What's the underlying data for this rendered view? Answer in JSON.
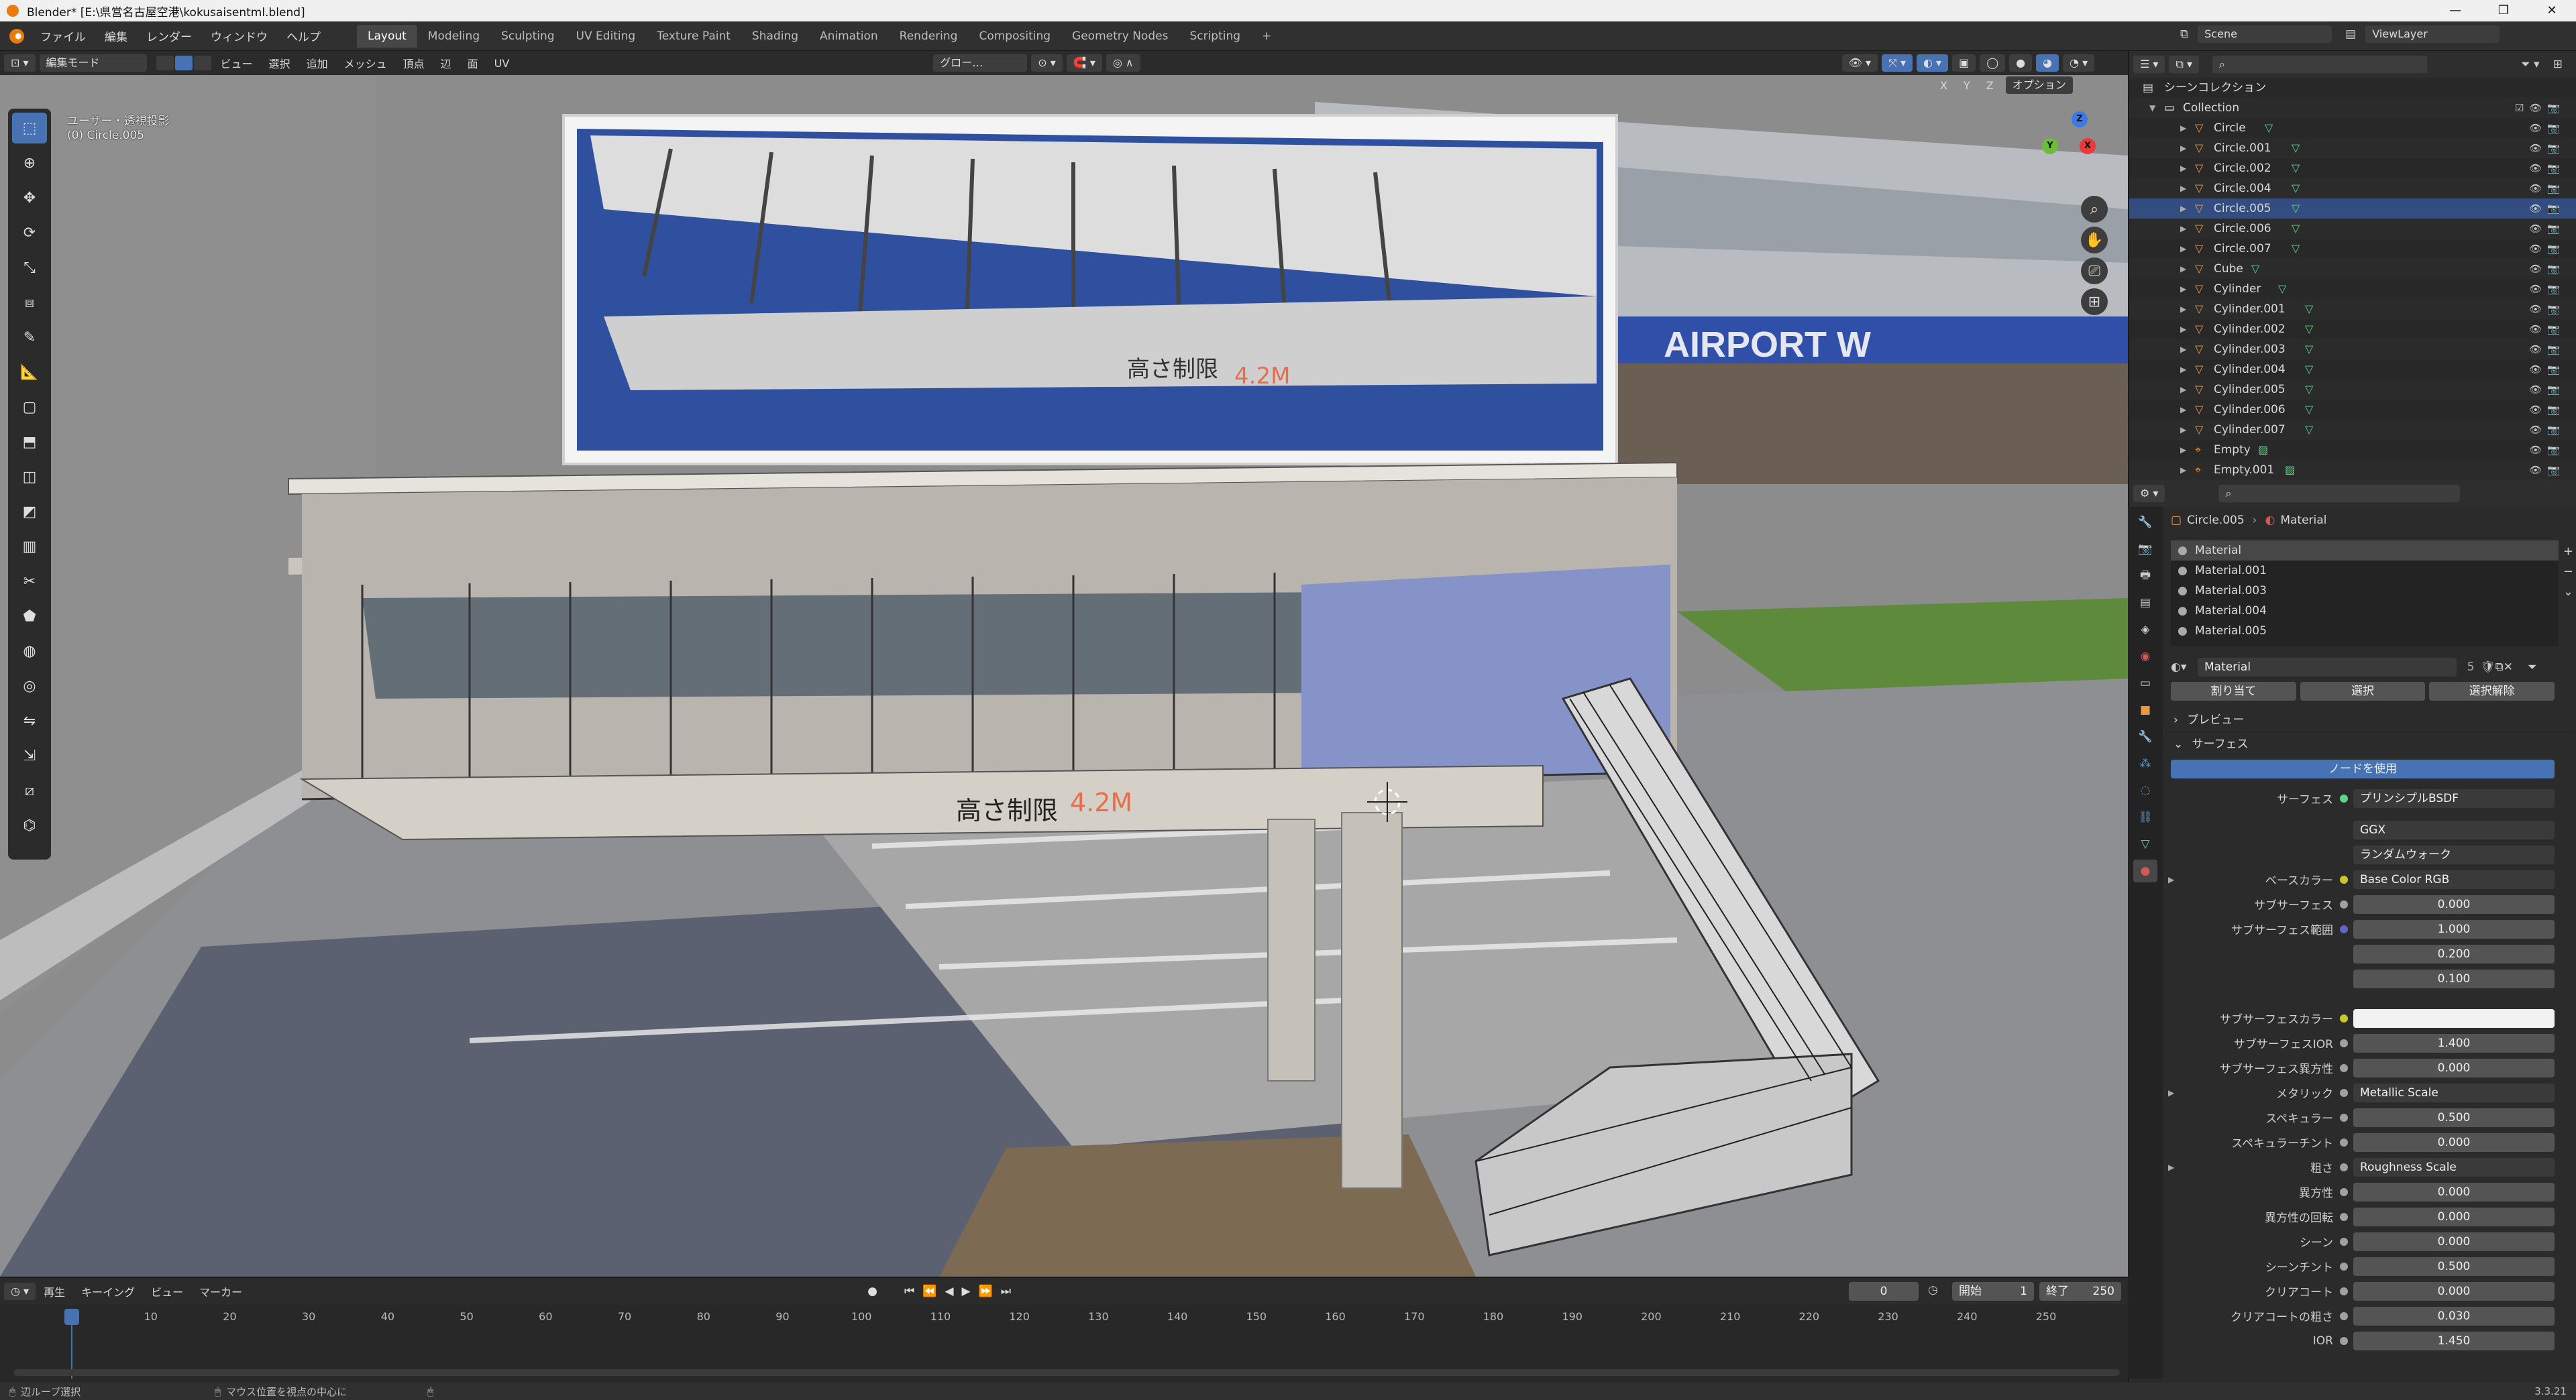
{
  "window": {
    "title": "Blender* [E:\\県営名古屋空港\\kokusaisentml.blend]",
    "controls": [
      "—",
      "❐",
      "✕"
    ]
  },
  "menu": [
    "ファイル",
    "編集",
    "レンダー",
    "ウィンドウ",
    "ヘルプ"
  ],
  "workspaces": [
    "Layout",
    "Modeling",
    "Sculpting",
    "UV Editing",
    "Texture Paint",
    "Shading",
    "Animation",
    "Rendering",
    "Compositing",
    "Geometry Nodes",
    "Scripting",
    "+"
  ],
  "scene": {
    "label": "Scene",
    "viewlayer": "ViewLayer"
  },
  "viewport_header": {
    "mode": "編集モード",
    "menus": [
      "ビュー",
      "選択",
      "追加",
      "メッシュ",
      "頂点",
      "辺",
      "面",
      "UV"
    ],
    "transform": "グロー…",
    "axes": [
      "X",
      "Y",
      "Z"
    ],
    "options": "オプション"
  },
  "viewport": {
    "view_name": "ユーザー・透視投影",
    "object_name": "(0) Circle.005",
    "sign_text": "高さ制限",
    "sign_value": "4.2M",
    "airport_text": "AIRPORT W",
    "gizmo": {
      "x": "X",
      "y": "Y",
      "z": "Z"
    }
  },
  "outliner": {
    "root": "シーンコレクション",
    "collection": "Collection",
    "items": [
      {
        "name": "Circle",
        "selected": false
      },
      {
        "name": "Circle.001",
        "selected": false
      },
      {
        "name": "Circle.002",
        "selected": false
      },
      {
        "name": "Circle.004",
        "selected": false
      },
      {
        "name": "Circle.005",
        "selected": true
      },
      {
        "name": "Circle.006",
        "selected": false
      },
      {
        "name": "Circle.007",
        "selected": false
      },
      {
        "name": "Cube",
        "selected": false
      },
      {
        "name": "Cylinder",
        "selected": false
      },
      {
        "name": "Cylinder.001",
        "selected": false
      },
      {
        "name": "Cylinder.002",
        "selected": false
      },
      {
        "name": "Cylinder.003",
        "selected": false
      },
      {
        "name": "Cylinder.004",
        "selected": false
      },
      {
        "name": "Cylinder.005",
        "selected": false
      },
      {
        "name": "Cylinder.006",
        "selected": false
      },
      {
        "name": "Cylinder.007",
        "selected": false
      },
      {
        "name": "Empty",
        "selected": false
      },
      {
        "name": "Empty.001",
        "selected": false
      }
    ]
  },
  "properties": {
    "breadcrumb_object": "Circle.005",
    "breadcrumb_material": "Material",
    "slots": [
      "Material",
      "Material.001",
      "Material.003",
      "Material.004",
      "Material.005"
    ],
    "material_name": "Material",
    "material_users": "5",
    "buttons": {
      "assign": "割り当て",
      "select": "選択",
      "deselect": "選択解除"
    },
    "preview": "プレビュー",
    "surface_section": "サーフェス",
    "use_nodes": "ノードを使用",
    "surface_label": "サーフェス",
    "surface_value": "プリンシプルBSDF",
    "distribution": "GGX",
    "subsurface_method": "ランダムウォーク",
    "fields": [
      {
        "label": "ベースカラー",
        "value": "Base Color RGB",
        "type": "link",
        "dot": "#c7c729"
      },
      {
        "label": "サブサーフェス",
        "value": "0.000",
        "type": "num",
        "fill": 0,
        "dot": "#a1a1a1"
      },
      {
        "label": "サブサーフェス範囲",
        "value": "1.000",
        "type": "num",
        "fill": 0,
        "dot": "#6363c7"
      },
      {
        "label": "",
        "value": "0.200",
        "type": "num",
        "fill": 0,
        "dot": ""
      },
      {
        "label": "",
        "value": "0.100",
        "type": "num",
        "fill": 0,
        "dot": ""
      },
      {
        "label": "サブサーフェスカラー",
        "value": "",
        "type": "color",
        "fill": 0,
        "dot": "#c7c729"
      },
      {
        "label": "サブサーフェスIOR",
        "value": "1.400",
        "type": "num",
        "fill": 0.12,
        "dot": "#a1a1a1"
      },
      {
        "label": "サブサーフェス異方性",
        "value": "0.000",
        "type": "num",
        "fill": 0,
        "dot": "#a1a1a1"
      },
      {
        "label": "メタリック",
        "value": "Metallic Scale",
        "type": "link",
        "dot": "#a1a1a1"
      },
      {
        "label": "スペキュラー",
        "value": "0.500",
        "type": "num",
        "fill": 0.5,
        "dot": "#a1a1a1"
      },
      {
        "label": "スペキュラーチント",
        "value": "0.000",
        "type": "num",
        "fill": 0,
        "dot": "#a1a1a1"
      },
      {
        "label": "粗さ",
        "value": "Roughness Scale",
        "type": "link",
        "dot": "#a1a1a1"
      },
      {
        "label": "異方性",
        "value": "0.000",
        "type": "num",
        "fill": 0,
        "dot": "#a1a1a1"
      },
      {
        "label": "異方性の回転",
        "value": "0.000",
        "type": "num",
        "fill": 0,
        "dot": "#a1a1a1"
      },
      {
        "label": "シーン",
        "value": "0.000",
        "type": "num",
        "fill": 0,
        "dot": "#a1a1a1"
      },
      {
        "label": "シーンチント",
        "value": "0.500",
        "type": "num",
        "fill": 0.5,
        "dot": "#a1a1a1"
      },
      {
        "label": "クリアコート",
        "value": "0.000",
        "type": "num",
        "fill": 0,
        "dot": "#a1a1a1"
      },
      {
        "label": "クリアコートの粗さ",
        "value": "0.030",
        "type": "num",
        "fill": 0.03,
        "dot": "#a1a1a1"
      },
      {
        "label": "IOR",
        "value": "1.450",
        "type": "num",
        "fill": 0,
        "dot": "#a1a1a1"
      }
    ]
  },
  "timeline": {
    "menus": [
      "再生",
      "キーイング",
      "ビュー",
      "マーカー"
    ],
    "current_frame": "0",
    "start_label": "開始",
    "start": "1",
    "end_label": "終了",
    "end": "250",
    "ticks": [
      "0",
      "10",
      "20",
      "30",
      "40",
      "50",
      "60",
      "70",
      "80",
      "90",
      "100",
      "110",
      "120",
      "130",
      "140",
      "150",
      "160",
      "170",
      "180",
      "190",
      "200",
      "210",
      "220",
      "230",
      "240",
      "250"
    ]
  },
  "status": {
    "left": "辺ループ選択",
    "middle": "マウス位置を視点の中心に",
    "version": "3.3.21"
  }
}
